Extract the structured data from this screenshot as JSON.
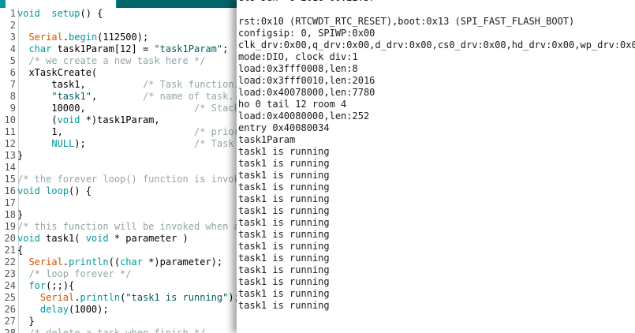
{
  "editor": {
    "lines": [
      {
        "n": "1",
        "segs": [
          [
            "kw",
            "void"
          ],
          [
            "",
            "  "
          ],
          [
            "kw",
            "setup"
          ],
          [
            "",
            "() {"
          ]
        ]
      },
      {
        "n": "2",
        "segs": []
      },
      {
        "n": "3",
        "segs": [
          [
            "",
            "  "
          ],
          [
            "fn",
            "Serial"
          ],
          [
            "",
            "."
          ],
          [
            "kw",
            "begin"
          ],
          [
            "",
            "(112500);"
          ]
        ]
      },
      {
        "n": "4",
        "segs": [
          [
            "",
            "  "
          ],
          [
            "kw",
            "char"
          ],
          [
            "",
            " task1Param[12] = "
          ],
          [
            "str",
            "\"task1Param\""
          ],
          [
            "",
            ";"
          ]
        ]
      },
      {
        "n": "5",
        "segs": [
          [
            "",
            "  "
          ],
          [
            "cmt",
            "/* we create a new task here */"
          ]
        ]
      },
      {
        "n": "6",
        "segs": [
          [
            "",
            "  xTaskCreate("
          ]
        ]
      },
      {
        "n": "7",
        "segs": [
          [
            "",
            "      task1,          "
          ],
          [
            "cmt",
            "/* Task function. */"
          ]
        ]
      },
      {
        "n": "8",
        "segs": [
          [
            "",
            "      "
          ],
          [
            "str",
            "\"task1\""
          ],
          [
            "",
            ",        "
          ],
          [
            "cmt",
            "/* name of task. */"
          ]
        ]
      },
      {
        "n": "9",
        "segs": [
          [
            "",
            "      10000,                   "
          ],
          [
            "cmt",
            "/* Stack size */"
          ]
        ]
      },
      {
        "n": "10",
        "segs": [
          [
            "",
            "      ("
          ],
          [
            "kw",
            "void"
          ],
          [
            "",
            " *)task1Param,"
          ]
        ]
      },
      {
        "n": "11",
        "segs": [
          [
            "",
            "      1,                       "
          ],
          [
            "cmt",
            "/* priority */"
          ]
        ]
      },
      {
        "n": "12",
        "segs": [
          [
            "",
            "      "
          ],
          [
            "kw",
            "NULL"
          ],
          [
            "",
            "); "
          ],
          [
            "",
            "                  "
          ],
          [
            "cmt",
            "/* Task handle */"
          ]
        ]
      },
      {
        "n": "13",
        "segs": [
          [
            "",
            "}"
          ]
        ]
      },
      {
        "n": "14",
        "segs": []
      },
      {
        "n": "15",
        "segs": [
          [
            "cmt",
            "/* the forever loop() function is invoked */"
          ]
        ]
      },
      {
        "n": "16",
        "segs": [
          [
            "kw",
            "void"
          ],
          [
            "",
            " "
          ],
          [
            "kw",
            "loop"
          ],
          [
            "",
            "() {"
          ]
        ]
      },
      {
        "n": "17",
        "segs": []
      },
      {
        "n": "18",
        "segs": [
          [
            "",
            "}"
          ]
        ]
      },
      {
        "n": "19",
        "segs": [
          [
            "cmt",
            "/* this function will be invoked when a */"
          ]
        ]
      },
      {
        "n": "20",
        "segs": [
          [
            "kw",
            "void"
          ],
          [
            "",
            " task1( "
          ],
          [
            "kw",
            "void"
          ],
          [
            "",
            " * parameter )"
          ]
        ]
      },
      {
        "n": "21",
        "segs": [
          [
            "",
            "{"
          ]
        ]
      },
      {
        "n": "22",
        "segs": [
          [
            "",
            "  "
          ],
          [
            "fn",
            "Serial"
          ],
          [
            "",
            "."
          ],
          [
            "kw",
            "println"
          ],
          [
            "",
            "(("
          ],
          [
            "kw",
            "char"
          ],
          [
            "",
            " *)parameter);"
          ]
        ]
      },
      {
        "n": "23",
        "segs": [
          [
            "",
            "  "
          ],
          [
            "cmt",
            "/* loop forever */"
          ]
        ]
      },
      {
        "n": "24",
        "segs": [
          [
            "",
            "  "
          ],
          [
            "kw",
            "for"
          ],
          [
            "",
            "(;;){"
          ]
        ]
      },
      {
        "n": "25",
        "segs": [
          [
            "",
            "    "
          ],
          [
            "fn",
            "Serial"
          ],
          [
            "",
            "."
          ],
          [
            "kw",
            "println"
          ],
          [
            "",
            "("
          ],
          [
            "str",
            "\"task1 is running\""
          ],
          [
            "",
            ");"
          ]
        ]
      },
      {
        "n": "26",
        "segs": [
          [
            "",
            "    "
          ],
          [
            "kw",
            "delay"
          ],
          [
            "",
            "(1000);"
          ]
        ]
      },
      {
        "n": "27",
        "segs": [
          [
            "",
            "  }"
          ]
        ]
      },
      {
        "n": "28",
        "segs": [
          [
            "",
            "  "
          ],
          [
            "cmt",
            "/* delete a task when finish */"
          ]
        ]
      }
    ]
  },
  "monitor": {
    "lines": [
      "ets Jun  8 2016 00:22:57",
      "",
      "rst:0x10 (RTCWDT_RTC_RESET),boot:0x13 (SPI_FAST_FLASH_BOOT)",
      "configsip: 0, SPIWP:0x00",
      "clk_drv:0x00,q_drv:0x00,d_drv:0x00,cs0_drv:0x00,hd_drv:0x00,wp_drv:0x00",
      "mode:DIO, clock div:1",
      "load:0x3fff0008,len:8",
      "load:0x3fff0010,len:2016",
      "load:0x40078000,len:7780",
      "ho 0 tail 12 room 4",
      "load:0x40080000,len:252",
      "entry 0x40080034",
      "task1Param",
      "task1 is running",
      "task1 is running",
      "task1 is running",
      "task1 is running",
      "task1 is running",
      "task1 is running",
      "task1 is running",
      "task1 is running",
      "task1 is running",
      "task1 is running",
      "task1 is running",
      "task1 is running",
      "task1 is running",
      "task1 is running"
    ]
  }
}
